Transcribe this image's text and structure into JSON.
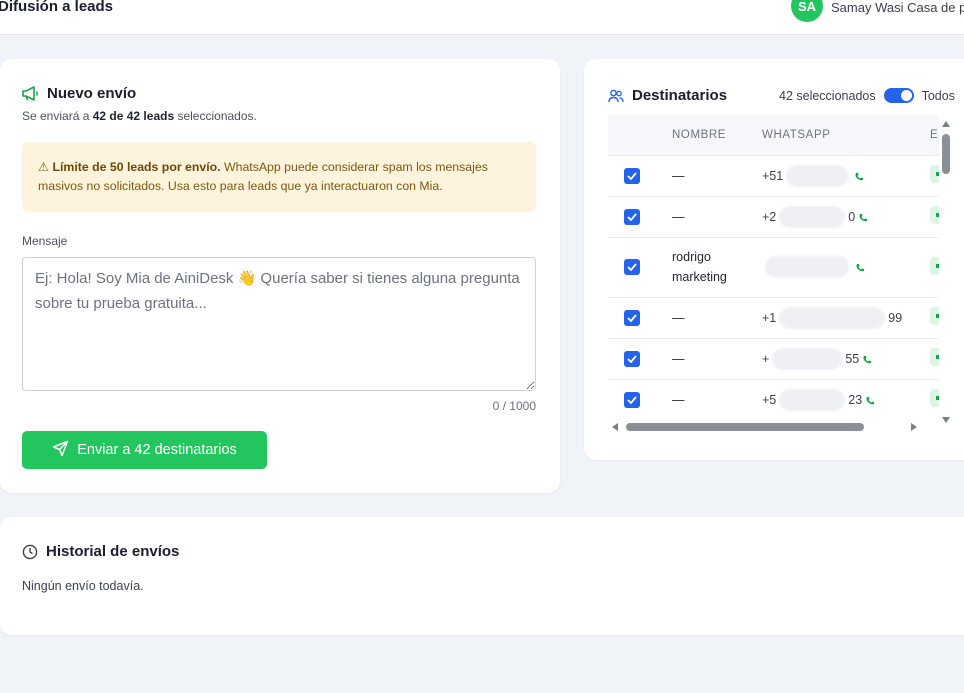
{
  "header": {
    "title": "Difusión a leads",
    "avatar_initials": "SA",
    "user_name": "Samay Wasi Casa de p"
  },
  "new_send": {
    "title": "Nuevo envío",
    "subtitle_prefix": "Se enviará a",
    "subtitle_count": "42 de 42 leads",
    "subtitle_suffix": "seleccionados.",
    "warning_icon": "⚠",
    "warning_bold": "Límite de 50 leads por envío.",
    "warning_text": "WhatsApp puede considerar spam los mensajes masivos no solicitados. Usa esto para leads que ya interactuaron con Mia.",
    "message_label": "Mensaje",
    "message_value": "",
    "message_placeholder": "Ej: Hola! Soy Mia de AiniDesk 👋 Quería saber si tienes alguna pregunta sobre tu prueba gratuita...",
    "counter": "0 / 1000",
    "send_button": "Enviar a 42 destinatarios"
  },
  "recipients": {
    "title": "Destinatarios",
    "selected_count": "42 seleccionados",
    "all_label": "Todos",
    "all_toggle_on": true,
    "columns": [
      "NOMBRE",
      "WHATSAPP",
      "ES"
    ],
    "rows": [
      {
        "name": "—",
        "wa_prefix": "+51",
        "wa_suffix": ""
      },
      {
        "name": "—",
        "wa_prefix": "+2",
        "wa_suffix": "0"
      },
      {
        "name": "rodrigo marketing",
        "wa_prefix": "",
        "wa_suffix": ""
      },
      {
        "name": "—",
        "wa_prefix": "+1",
        "wa_suffix": "99"
      },
      {
        "name": "—",
        "wa_prefix": "+",
        "wa_suffix": "55"
      },
      {
        "name": "—",
        "wa_prefix": "+5",
        "wa_suffix": "23"
      }
    ]
  },
  "history": {
    "title": "Historial de envíos",
    "empty_text": "Ningún envío todavía."
  },
  "colors": {
    "accent_green": "#22c55e",
    "accent_blue": "#2563eb",
    "warning_bg": "#fef3dc"
  }
}
